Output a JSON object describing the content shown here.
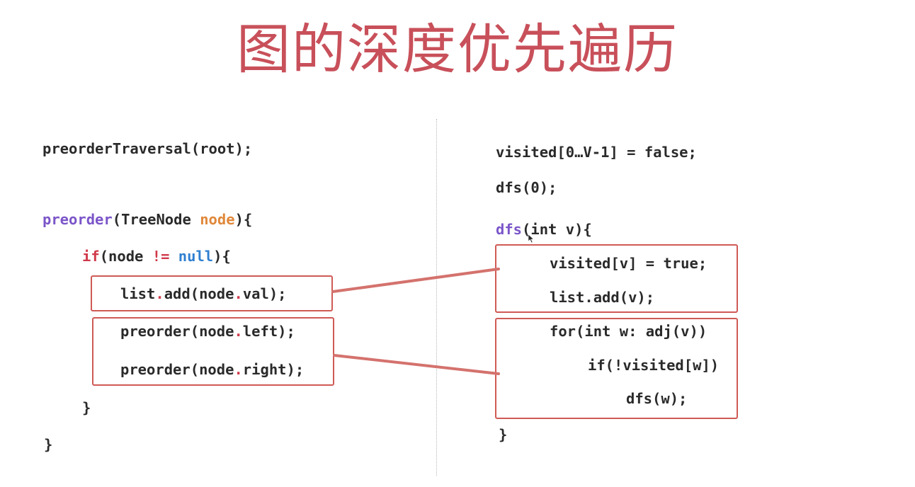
{
  "title": "图的深度优先遍历",
  "left": {
    "line1": "preorderTraversal(root);",
    "preorder_fn": "preorder",
    "paren_open": "(",
    "param_type": "TreeNode ",
    "param_name": "node",
    "paren_close_brace": "){",
    "if_kw": "if",
    "if_open": "(node ",
    "neq": "!=",
    "null_kw": "null",
    "if_close": "){",
    "list_a": "list",
    "dot1": ".",
    "list_b": "add(node",
    "dot2": ".",
    "list_c": "val);",
    "pre_left_a": "preorder(node",
    "pre_left_dot": ".",
    "pre_left_b": "left);",
    "pre_right_a": "preorder(node",
    "pre_right_dot": ".",
    "pre_right_b": "right);",
    "close_inner": "}",
    "close_outer": "}"
  },
  "right": {
    "line1": "visited[0…V-1] = false;",
    "line2": "dfs(0);",
    "dfs_fn": "dfs",
    "dfs_sig": "(int v){",
    "visited_v": "visited[v] = true;",
    "list_add_v": "list.add(v);",
    "for_line": "for(int w: adj(v))",
    "if_line": "if(!visited[w])",
    "dfs_w": "dfs(w);",
    "close": "}"
  },
  "colors": {
    "title": "#c8505a",
    "box": "#cf5a55",
    "keyword_purple": "#7b55c9",
    "param_orange": "#e0883a",
    "if_red": "#d03a4b",
    "null_blue": "#2f7fd1"
  }
}
